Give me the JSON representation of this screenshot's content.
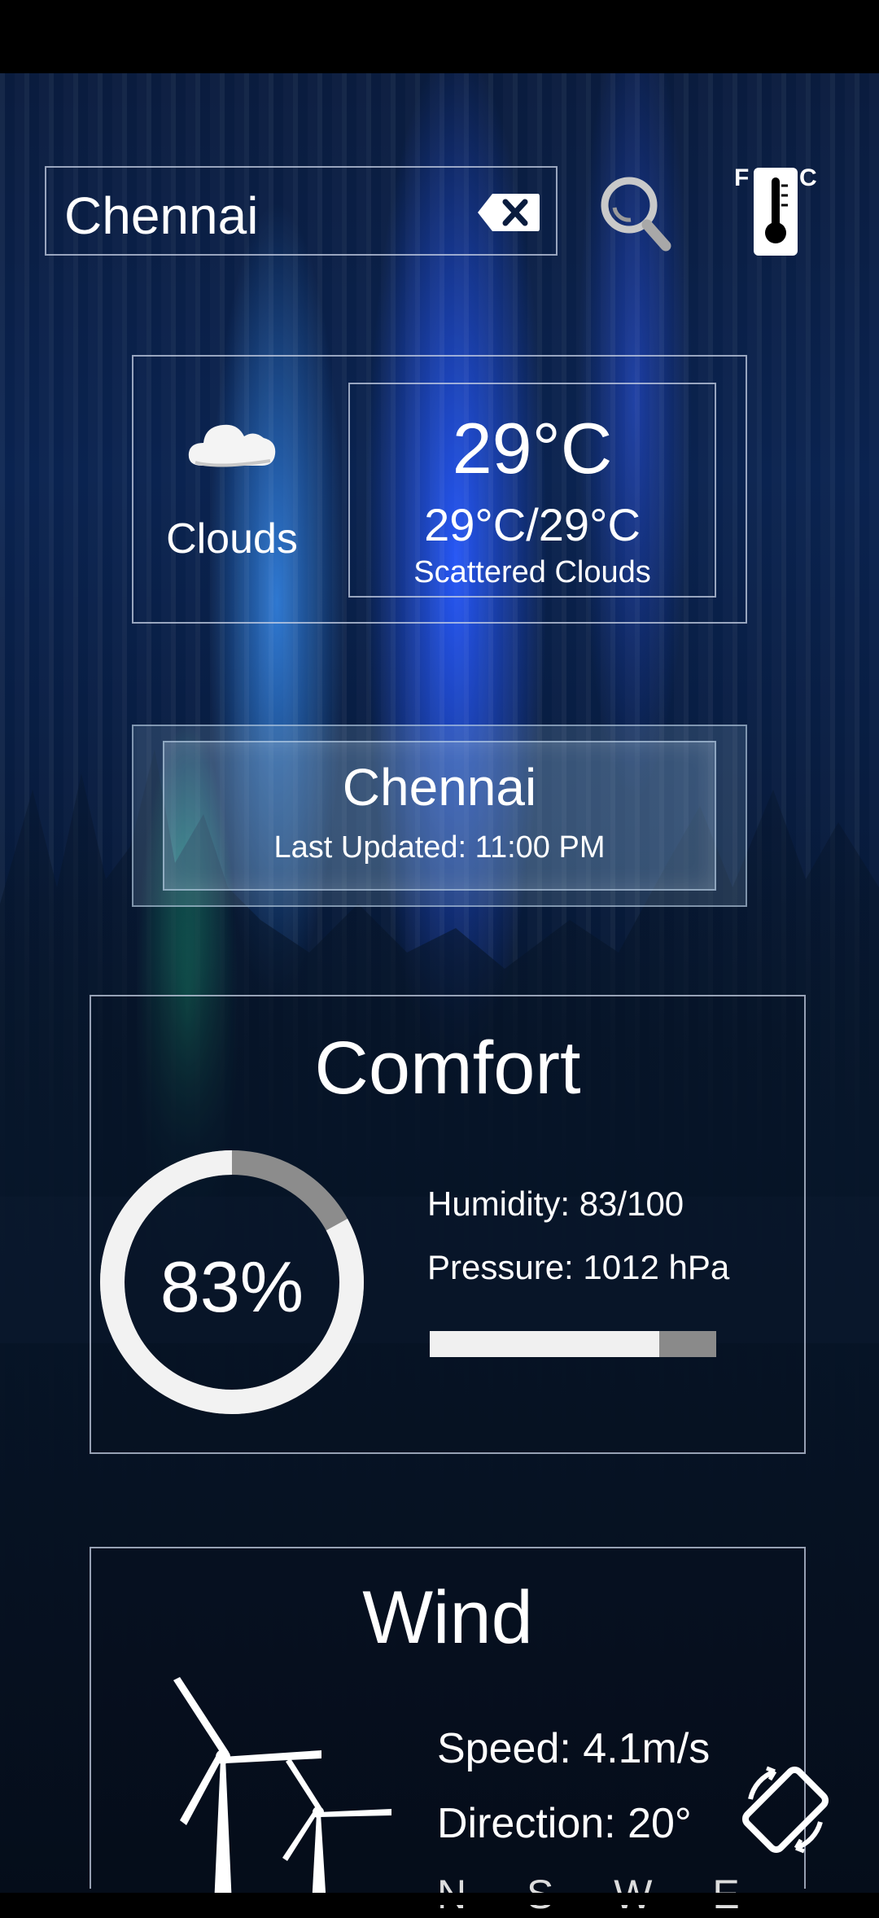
{
  "search": {
    "value": "Chennai"
  },
  "current": {
    "condition": "Clouds",
    "temperature": "29°C",
    "range": "29°C/29°C",
    "description": "Scattered Clouds"
  },
  "location": {
    "city": "Chennai",
    "last_updated": "Last Updated: 11:00 PM"
  },
  "comfort": {
    "title": "Comfort",
    "humidity_percent_label": "83%",
    "humidity_fraction": 0.83,
    "humidity": "Humidity: 83/100",
    "pressure": "Pressure: 1012 hPa",
    "pressure_bar_fraction": 0.8
  },
  "wind": {
    "title": "Wind",
    "speed": "Speed: 4.1m/s",
    "direction": "Direction: 20°",
    "compass": "N S W E"
  },
  "icons": {
    "clear": "backspace-clear-icon",
    "search": "search-icon",
    "unit_toggle": "fahrenheit-celsius-thermometer-icon",
    "weather": "cloud-icon",
    "rotate": "screen-rotate-icon",
    "wind": "wind-turbine-icon"
  },
  "unit_toggle": {
    "left": "F",
    "right": "C"
  },
  "colors": {
    "ring": "#f2f2f2",
    "ring_track": "#8c8c8c",
    "border": "#c8d2e6"
  }
}
